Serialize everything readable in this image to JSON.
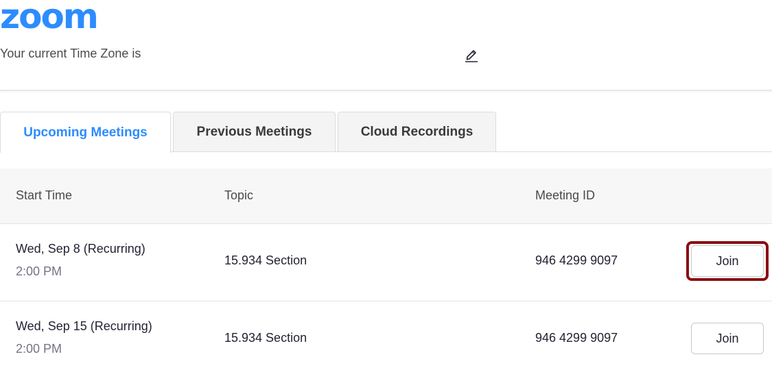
{
  "header": {
    "logo": "zoom",
    "timezone_label": "Your current Time Zone is",
    "edit_icon": "pencil-icon"
  },
  "tabs": [
    {
      "label": "Upcoming Meetings",
      "active": true
    },
    {
      "label": "Previous Meetings",
      "active": false
    },
    {
      "label": "Cloud Recordings",
      "active": false
    }
  ],
  "table": {
    "columns": [
      "Start Time",
      "Topic",
      "Meeting ID"
    ],
    "rows": [
      {
        "date": "Wed, Sep 8 (Recurring)",
        "time": "2:00 PM",
        "topic": "15.934 Section",
        "meeting_id": "946 4299 9097",
        "action": "Join",
        "highlighted": true
      },
      {
        "date": "Wed, Sep 15 (Recurring)",
        "time": "2:00 PM",
        "topic": "15.934 Section",
        "meeting_id": "946 4299 9097",
        "action": "Join",
        "highlighted": false
      }
    ]
  },
  "colors": {
    "brand": "#2d8cff",
    "highlight_border": "#8b0d12",
    "time_text": "#747487"
  }
}
